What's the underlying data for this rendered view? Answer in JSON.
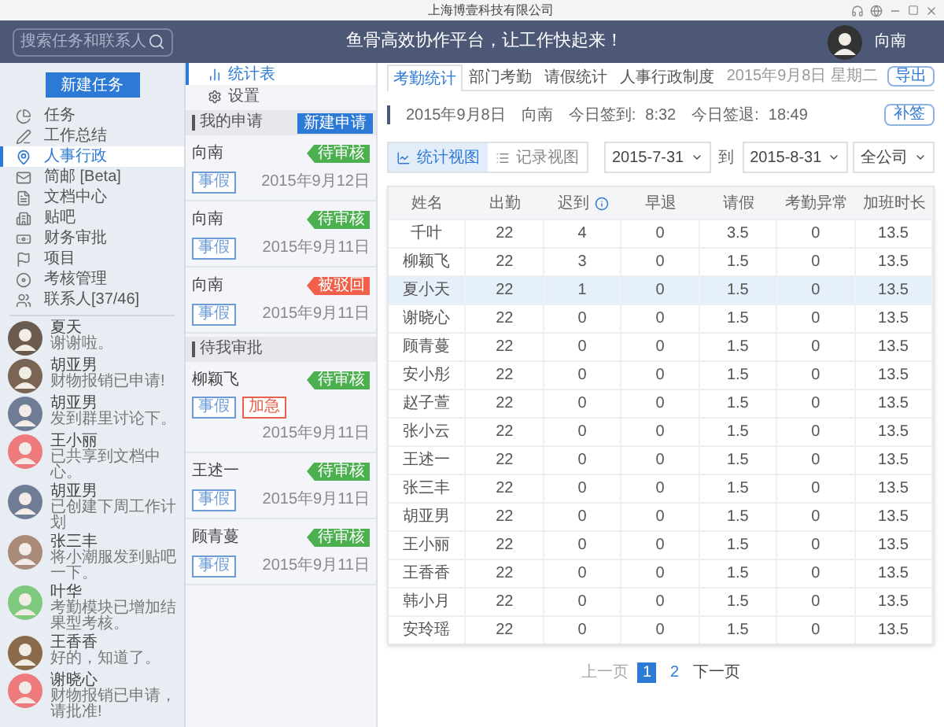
{
  "window": {
    "title": "上海博壹科技有限公司"
  },
  "header": {
    "search": {
      "placeholder": "搜索任务和联系人"
    },
    "slogan": "鱼骨高效协作平台，让工作快起来！",
    "user": "向南"
  },
  "sidebar": {
    "new_task": "新建任务",
    "items": [
      {
        "label": "任务",
        "selected": false
      },
      {
        "label": "工作总结",
        "selected": false
      },
      {
        "label": "人事行政",
        "selected": true
      },
      {
        "label": "简邮 [Beta]",
        "selected": false
      },
      {
        "label": "文档中心",
        "selected": false
      },
      {
        "label": "贴吧",
        "selected": false
      },
      {
        "label": "财务审批",
        "selected": false
      },
      {
        "label": "项目",
        "selected": false
      },
      {
        "label": "考核管理",
        "selected": false
      },
      {
        "label": "联系人[37/46]",
        "selected": false
      }
    ],
    "contacts": [
      {
        "name": "夏天",
        "message": "谢谢啦。",
        "color": "#6b5a4e"
      },
      {
        "name": "胡亚男",
        "message": "财物报销已申请!",
        "color": "#7a6454"
      },
      {
        "name": "胡亚男",
        "message": "发到群里讨论下。",
        "color": "#6f7c95"
      },
      {
        "name": "王小丽",
        "message": "已共享到文档中心。",
        "color": "#ee7b7b"
      },
      {
        "name": "胡亚男",
        "message": "已创建下周工作计划",
        "color": "#6f7c95"
      },
      {
        "name": "张三丰",
        "message": "将小潮服发到贴吧一下。",
        "color": "#a98a78"
      },
      {
        "name": "叶华",
        "message": "考勤模块已增加结果型考核。",
        "color": "#7fc97f"
      },
      {
        "name": "王香香",
        "message": "好的，知道了。",
        "color": "#8a6a4a"
      },
      {
        "name": "谢晓心",
        "message": "财物报销已申请，请批准!",
        "color": "#ee7b7b"
      }
    ]
  },
  "requests": {
    "tabs": [
      {
        "label": "统计表",
        "selected": true
      },
      {
        "label": "设置",
        "selected": false
      }
    ],
    "sections": [
      {
        "title": "我的申请",
        "button": "新建申请",
        "items": [
          {
            "name": "向南",
            "tags": [
              {
                "label": "事假",
                "color": "#6c9bd8"
              }
            ],
            "status": "待审核",
            "color": "#4caf50",
            "date": "2015年9月12日"
          },
          {
            "name": "向南",
            "tags": [
              {
                "label": "事假",
                "color": "#6c9bd8"
              }
            ],
            "status": "待审核",
            "color": "#4caf50",
            "date": "2015年9月11日"
          },
          {
            "name": "向南",
            "tags": [
              {
                "label": "事假",
                "color": "#6c9bd8"
              }
            ],
            "status": "被驳回",
            "color": "#f0604a",
            "date": "2015年9月11日"
          }
        ]
      },
      {
        "title": "待我审批",
        "items": [
          {
            "name": "柳颖飞",
            "tags": [
              {
                "label": "事假",
                "color": "#6c9bd8"
              },
              {
                "label": "加急",
                "color": "#e8604c"
              }
            ],
            "status": "待审核",
            "color": "#4caf50",
            "date": "2015年9月11日"
          },
          {
            "name": "王述一",
            "tags": [
              {
                "label": "事假",
                "color": "#6c9bd8"
              }
            ],
            "status": "待审核",
            "color": "#4caf50",
            "date": "2015年9月11日"
          },
          {
            "name": "顾青蔓",
            "tags": [
              {
                "label": "事假",
                "color": "#6c9bd8"
              }
            ],
            "status": "待审核",
            "color": "#4caf50",
            "date": "2015年9月11日"
          }
        ]
      }
    ]
  },
  "main": {
    "tabs": [
      {
        "label": "考勤统计",
        "selected": true
      },
      {
        "label": "部门考勤",
        "selected": false
      },
      {
        "label": "请假统计",
        "selected": false
      },
      {
        "label": "人事行政制度",
        "selected": false
      }
    ],
    "date": "2015年9月8日",
    "weekday": "星期二",
    "export": "导出",
    "info": {
      "date": "2015年9月8日",
      "name": "向南",
      "checkin_label": "今日签到:",
      "checkin": "8:32",
      "checkout_label": "今日签退:",
      "checkout": "18:49",
      "button": "补签"
    },
    "views": [
      {
        "label": "统计视图",
        "selected": true
      },
      {
        "label": "记录视图",
        "selected": false
      }
    ],
    "from": "2015-7-31",
    "to_label": "到",
    "to": "2015-8-31",
    "scope": "全公司",
    "table": {
      "columns": [
        {
          "label": "姓名",
          "kind": "plain"
        },
        {
          "label": "出勤",
          "kind": "plain"
        },
        {
          "label": "迟到",
          "kind": "info"
        },
        {
          "label": "早退",
          "kind": "plain"
        },
        {
          "label": "请假",
          "kind": "plain"
        },
        {
          "label": "考勤异常",
          "kind": "plain"
        },
        {
          "label": "加班时长",
          "kind": "plain"
        }
      ],
      "rows": [
        {
          "selected": false,
          "cells": [
            "千叶",
            "22",
            "4",
            "0",
            "3.5",
            "0",
            "13.5"
          ]
        },
        {
          "selected": false,
          "cells": [
            "柳颖飞",
            "22",
            "3",
            "0",
            "1.5",
            "0",
            "13.5"
          ]
        },
        {
          "selected": true,
          "cells": [
            "夏小天",
            "22",
            "1",
            "0",
            "1.5",
            "0",
            "13.5"
          ]
        },
        {
          "selected": false,
          "cells": [
            "谢晓心",
            "22",
            "0",
            "0",
            "1.5",
            "0",
            "13.5"
          ]
        },
        {
          "selected": false,
          "cells": [
            "顾青蔓",
            "22",
            "0",
            "0",
            "1.5",
            "0",
            "13.5"
          ]
        },
        {
          "selected": false,
          "cells": [
            "安小彤",
            "22",
            "0",
            "0",
            "1.5",
            "0",
            "13.5"
          ]
        },
        {
          "selected": false,
          "cells": [
            "赵子萱",
            "22",
            "0",
            "0",
            "1.5",
            "0",
            "13.5"
          ]
        },
        {
          "selected": false,
          "cells": [
            "张小云",
            "22",
            "0",
            "0",
            "1.5",
            "0",
            "13.5"
          ]
        },
        {
          "selected": false,
          "cells": [
            "王述一",
            "22",
            "0",
            "0",
            "1.5",
            "0",
            "13.5"
          ]
        },
        {
          "selected": false,
          "cells": [
            "张三丰",
            "22",
            "0",
            "0",
            "1.5",
            "0",
            "13.5"
          ]
        },
        {
          "selected": false,
          "cells": [
            "胡亚男",
            "22",
            "0",
            "0",
            "1.5",
            "0",
            "13.5"
          ]
        },
        {
          "selected": false,
          "cells": [
            "王小丽",
            "22",
            "0",
            "0",
            "1.5",
            "0",
            "13.5"
          ]
        },
        {
          "selected": false,
          "cells": [
            "王香香",
            "22",
            "0",
            "0",
            "1.5",
            "0",
            "13.5"
          ]
        },
        {
          "selected": false,
          "cells": [
            "韩小月",
            "22",
            "0",
            "0",
            "1.5",
            "0",
            "13.5"
          ]
        },
        {
          "selected": false,
          "cells": [
            "安玲瑶",
            "22",
            "0",
            "0",
            "1.5",
            "0",
            "13.5"
          ]
        }
      ]
    },
    "pagination": {
      "prev": "上一页",
      "pages": [
        {
          "label": "1",
          "selected": true
        },
        {
          "label": "2",
          "selected": false
        }
      ],
      "next": "下一页"
    }
  }
}
